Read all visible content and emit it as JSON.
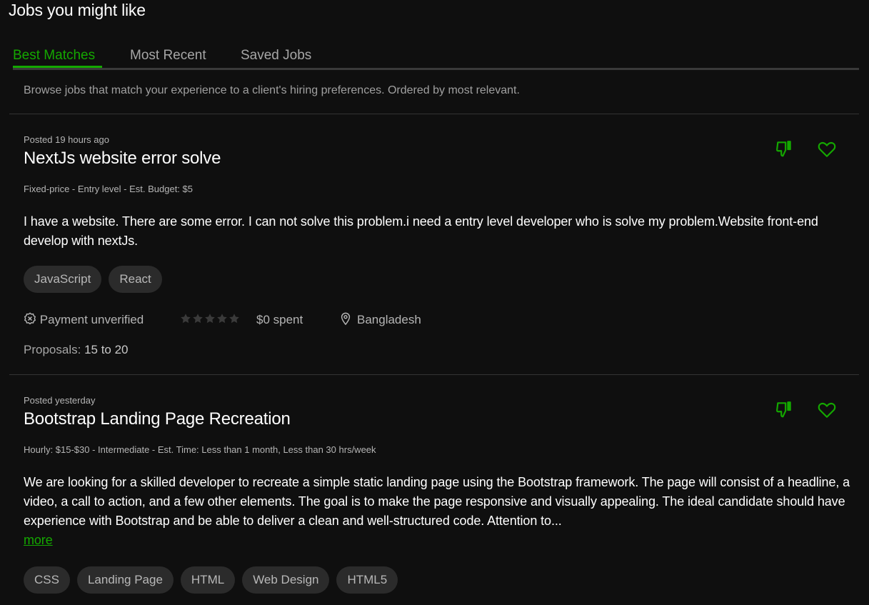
{
  "header": {
    "title": "Jobs you might like"
  },
  "tabs": [
    {
      "label": "Best Matches",
      "active": true
    },
    {
      "label": "Most Recent",
      "active": false
    },
    {
      "label": "Saved Jobs",
      "active": false
    }
  ],
  "subtitle": "Browse jobs that match your experience to a client's hiring preferences. Ordered by most relevant.",
  "colors": {
    "accent": "#14a800",
    "background": "#0f0f0f",
    "tag_bg": "#2b2b2b"
  },
  "jobs": [
    {
      "posted": "Posted 19 hours ago",
      "title": "NextJs website error solve",
      "meta": "Fixed-price - Entry level - Est. Budget: $5",
      "description": "I have a website. There are some error. I can not solve this problem.i need a entry level developer who is solve my problem.Website front-end develop with nextJs.",
      "tags": [
        "JavaScript",
        "React"
      ],
      "payment": "Payment unverified",
      "rating": 0,
      "spent": "$0 spent",
      "location": "Bangladesh",
      "proposals_label": "Proposals:",
      "proposals_value": "15 to 20",
      "dislike_icon": "thumbs-down-icon",
      "save_icon": "heart-icon"
    },
    {
      "posted": "Posted yesterday",
      "title": "Bootstrap Landing Page Recreation",
      "meta": "Hourly: $15-$30 - Intermediate - Est. Time: Less than 1 month, Less than 30 hrs/week",
      "description": "We are looking for a skilled developer to recreate a simple static landing page using the Bootstrap framework. The page will consist of a headline, a video, a call to action, and a few other elements. The goal is to make the page responsive and visually appealing. The ideal candidate should have experience with Bootstrap and be able to deliver a clean and well-structured code. Attention to...",
      "more_label": "more",
      "tags": [
        "CSS",
        "Landing Page",
        "HTML",
        "Web Design",
        "HTML5"
      ],
      "dislike_icon": "thumbs-down-icon",
      "save_icon": "heart-icon"
    }
  ]
}
